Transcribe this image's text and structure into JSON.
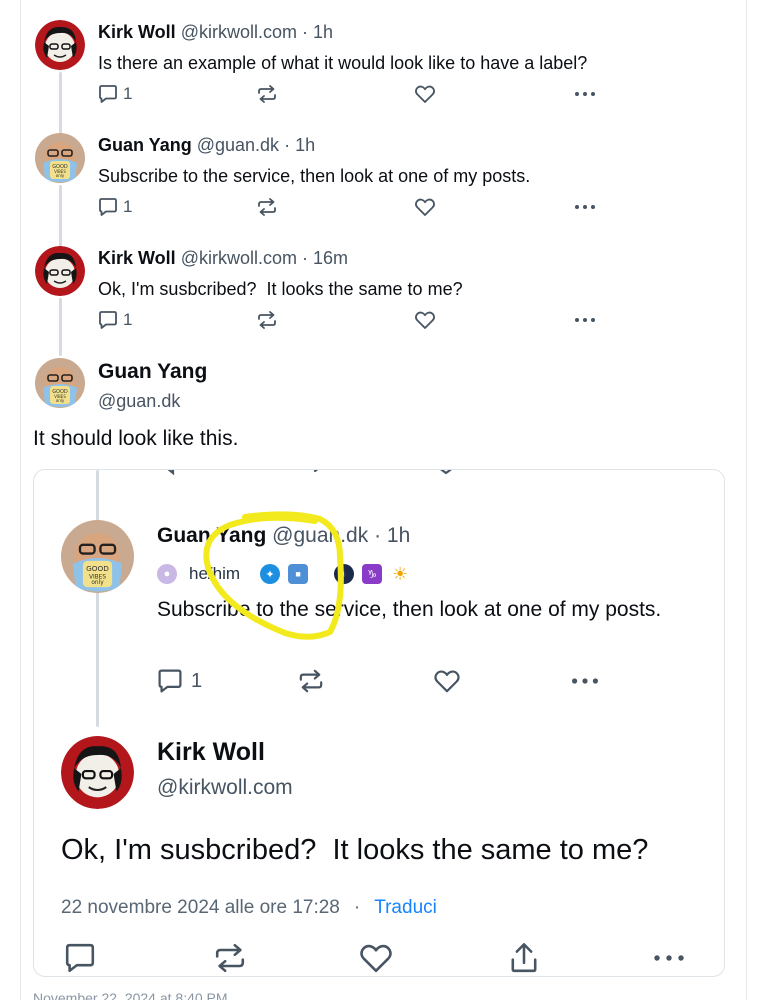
{
  "replies": [
    {
      "name": "Kirk Woll",
      "handle": "@kirkwoll.com",
      "sep": "·",
      "time": "1h",
      "text": "Is there an example of what it would look like to have a label?",
      "reply_count": "1"
    },
    {
      "name": "Guan Yang",
      "handle": "@guan.dk",
      "sep": "·",
      "time": "1h",
      "text": "Subscribe to the service, then look at one of my posts.",
      "reply_count": "1"
    },
    {
      "name": "Kirk Woll",
      "handle": "@kirkwoll.com",
      "sep": "·",
      "time": "16m",
      "text": "Ok, I'm susbcribed?  It looks the same to me?",
      "reply_count": "1"
    }
  ],
  "focus_post": {
    "name": "Guan Yang",
    "handle": "@guan.dk",
    "text": "It should look like this."
  },
  "embed": {
    "post": {
      "name": "Guan Yang",
      "handle": "@guan.dk",
      "sep": "·",
      "time": "1h",
      "pronouns": "he/him",
      "text": "Subscribe to the service, then look at one of my posts.",
      "reply_count": "1"
    },
    "focus": {
      "name": "Kirk Woll",
      "handle": "@kirkwoll.com",
      "text": "Ok, I'm susbcribed?  It looks the same to me?",
      "date": "22 novembre 2024 alle ore 17:28",
      "sep": "·",
      "translate": "Traduci"
    }
  },
  "footer_text": "November 22, 2024 at 8:40 PM",
  "colors": {
    "highlight": "#f2ea1c",
    "link": "#1683ff",
    "secondary_text": "#475462"
  },
  "icons": [
    "reply-icon",
    "repost-icon",
    "like-icon",
    "more-icon",
    "share-icon"
  ]
}
